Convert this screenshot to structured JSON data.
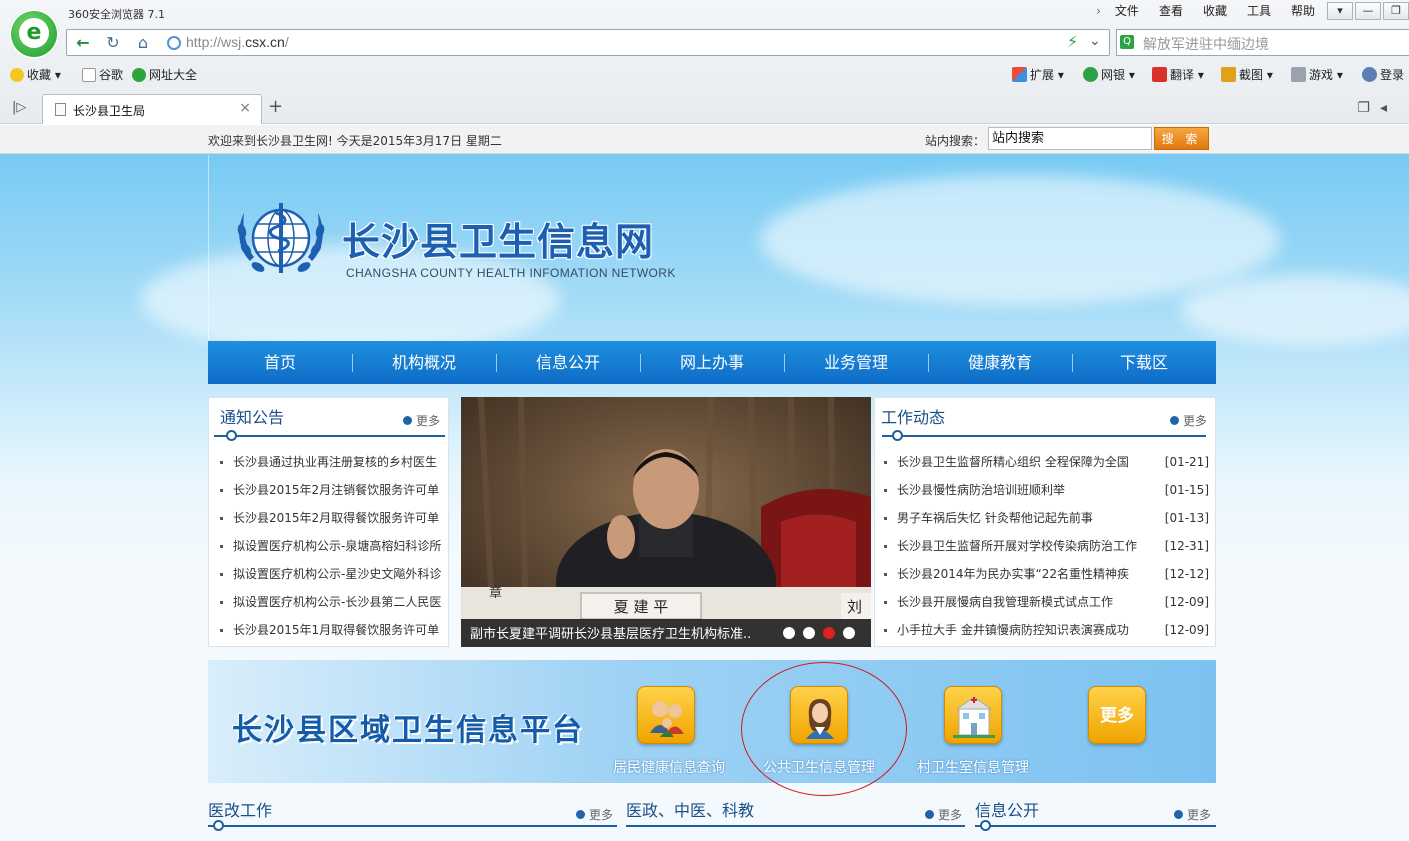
{
  "browser": {
    "app_title": "360安全浏览器 7.1",
    "menu": [
      "文件",
      "查看",
      "收藏",
      "工具",
      "帮助"
    ],
    "url_prefix": "http://wsj.",
    "url_host": "csx.cn",
    "url_suffix": "/",
    "search_placeholder": "解放军进驻中缅边境",
    "search_logo": "Q",
    "bookmarks": {
      "fav": "收藏",
      "google": "谷歌",
      "sites": "网址大全"
    },
    "tools": [
      "扩展",
      "网银",
      "翻译",
      "截图",
      "游戏",
      "登录"
    ],
    "tab_title": "长沙县卫生局",
    "logo_letter": "e",
    "colors": {
      "accent": "#1c9a2c",
      "search_accent": "#2ba245"
    }
  },
  "site": {
    "welcome": "欢迎来到长沙县卫生网! 今天是2015年3月17日  星期二",
    "search_label": "站内搜索：",
    "search_value": "站内搜索",
    "search_button": "搜 索",
    "title": "长沙县卫生信息网",
    "subtitle": "CHANGSHA COUNTY HEALTH INFOMATION NETWORK",
    "nav": [
      "首页",
      "机构概况",
      "信息公开",
      "网上办事",
      "业务管理",
      "健康教育",
      "下载区"
    ],
    "more": "更多",
    "notice": {
      "title": "通知公告",
      "items": [
        "长沙县通过执业再注册复核的乡村医生",
        "长沙县2015年2月注销餐饮服务许可单",
        "长沙县2015年2月取得餐饮服务许可单",
        "拟设置医疗机构公示-泉塘高榕妇科诊所",
        "拟设置医疗机构公示-星沙史文飚外科诊",
        "拟设置医疗机构公示-长沙县第二人民医",
        "长沙县2015年1月取得餐饮服务许可单"
      ]
    },
    "slide": {
      "caption": "副市长夏建平调研长沙县基层医疗卫生机构标准..",
      "nameplate_main": "夏 建 平",
      "nameplate_left": "章",
      "nameplate_right": "刘",
      "dots": 4,
      "active_dot": 3
    },
    "work": {
      "title": "工作动态",
      "items": [
        {
          "text": "长沙县卫生监督所精心组织 全程保障为全国",
          "date": "[01-21]"
        },
        {
          "text": "长沙县慢性病防治培训班顺利举",
          "date": "[01-15]"
        },
        {
          "text": "男子车祸后失忆 针灸帮他记起先前事",
          "date": "[01-13]"
        },
        {
          "text": "长沙县卫生监督所开展对学校传染病防治工作",
          "date": "[12-31]"
        },
        {
          "text": "长沙县2014年为民办实事“22名重性精神疾",
          "date": "[12-12]"
        },
        {
          "text": "长沙县开展慢病自我管理新模式试点工作",
          "date": "[12-09]"
        },
        {
          "text": "小手拉大手 金井镇慢病防控知识表演赛成功",
          "date": "[12-09]"
        }
      ]
    },
    "platform": {
      "title": "长沙县区域卫生信息平台",
      "buttons": [
        {
          "label": "居民健康信息查询",
          "icon": "family-icon"
        },
        {
          "label": "公共卫生信息管理",
          "icon": "nurse-icon"
        },
        {
          "label": "村卫生室信息管理",
          "icon": "clinic-icon"
        },
        {
          "label": "",
          "icon": "more-icon",
          "text": "更多"
        }
      ]
    },
    "bottom_sections": [
      "医改工作",
      "医政、中医、科教",
      "信息公开"
    ],
    "colors": {
      "nav_blue": "#1278d3",
      "title_blue": "#1d5fb1",
      "search_orange": "#f0902a",
      "active_dot": "#e0201e"
    }
  }
}
